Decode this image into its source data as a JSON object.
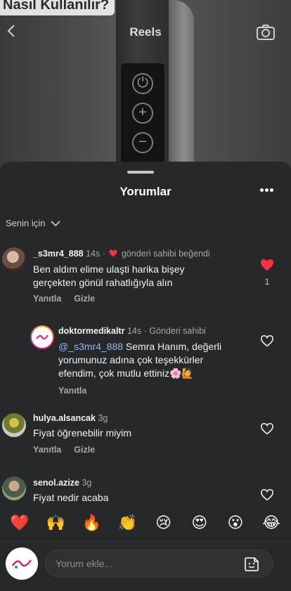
{
  "header": {
    "overlay_text": "Nasıl Kullanılır?",
    "title": "Reels",
    "back_icon": "chevron-left-icon",
    "camera_icon": "camera-icon"
  },
  "sheet": {
    "title": "Yorumlar",
    "filter_label": "Senin için"
  },
  "comments": [
    {
      "username": "_s3mr4_888",
      "time": "14s",
      "liked_by_owner": "gönderi sahibi beğendi",
      "text_line1": "Ben aldım elime ulaşti harika bişey",
      "text_line2": "gerçekten gönül rahatlığıyla alın",
      "reply_label": "Yanıtla",
      "hide_label": "Gizle",
      "like_count": "1",
      "liked": true
    },
    {
      "username": "doktormedikaltr",
      "time": "14s",
      "owner_label": "Gönderi sahibi",
      "mention": "@_s3mr4_888",
      "text_line1": " Semra Hanım, değerli",
      "text_line2": "yorumunuz adına çok teşekkürler",
      "text_line3": "efendim, çok mutlu ettiniz🌸🙋",
      "reply_label": "Yanıtla"
    },
    {
      "username": "hulya.alsancak",
      "time": "3g",
      "text_line1": "Fiyat öğrenebilir miyim",
      "reply_label": "Yanıtla",
      "hide_label": "Gizle"
    },
    {
      "username": "senol.azize",
      "time": "3g",
      "text_line1": "Fiyat nedir acaba"
    }
  ],
  "emojis": [
    "❤️",
    "🙌",
    "🔥",
    "👏",
    "😢",
    "😍",
    "😮",
    "😂"
  ],
  "composer": {
    "placeholder": "Yorum ekle...",
    "sticker_icon": "sticker-icon"
  },
  "colors": {
    "sheet_bg": "#26282a",
    "like_red": "#ff3040",
    "mention_blue": "#8fb6ff"
  }
}
